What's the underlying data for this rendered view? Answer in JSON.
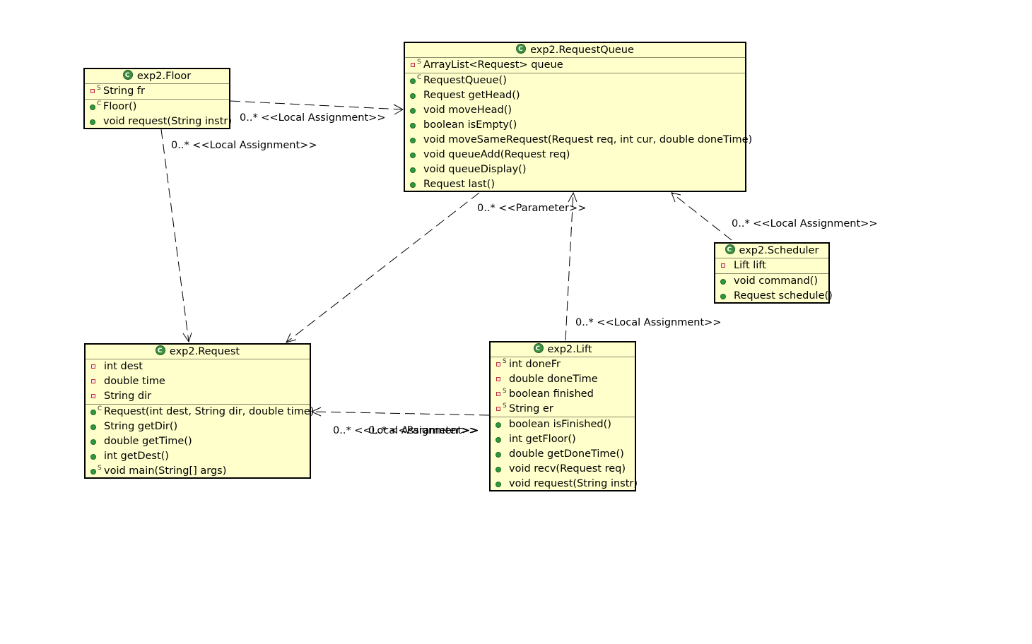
{
  "classes": {
    "floor": {
      "title": "exp2.Floor",
      "fields": [
        {
          "text": "String fr",
          "mod": "S"
        }
      ],
      "methods": [
        {
          "text": "Floor()",
          "mod": "C"
        },
        {
          "text": "void request(String instr)",
          "mod": ""
        }
      ]
    },
    "request_queue": {
      "title": "exp2.RequestQueue",
      "fields": [
        {
          "text": "ArrayList<Request> queue",
          "mod": "S"
        }
      ],
      "methods": [
        {
          "text": "RequestQueue()",
          "mod": "C"
        },
        {
          "text": "Request getHead()",
          "mod": ""
        },
        {
          "text": "void moveHead()",
          "mod": ""
        },
        {
          "text": "boolean isEmpty()",
          "mod": ""
        },
        {
          "text": "void moveSameRequest(Request req, int cur, double doneTime)",
          "mod": ""
        },
        {
          "text": "void queueAdd(Request req)",
          "mod": ""
        },
        {
          "text": "void queueDisplay()",
          "mod": ""
        },
        {
          "text": "Request last()",
          "mod": ""
        }
      ]
    },
    "scheduler": {
      "title": "exp2.Scheduler",
      "fields": [
        {
          "text": "Lift lift",
          "mod": ""
        }
      ],
      "methods": [
        {
          "text": "void command()",
          "mod": ""
        },
        {
          "text": "Request schedule()",
          "mod": ""
        }
      ]
    },
    "request": {
      "title": "exp2.Request",
      "fields": [
        {
          "text": "int dest",
          "mod": ""
        },
        {
          "text": "double time",
          "mod": ""
        },
        {
          "text": "String dir",
          "mod": ""
        }
      ],
      "methods": [
        {
          "text": "Request(int dest, String dir, double time)",
          "mod": "C"
        },
        {
          "text": "String getDir()",
          "mod": ""
        },
        {
          "text": "double getTime()",
          "mod": ""
        },
        {
          "text": "int getDest()",
          "mod": ""
        },
        {
          "text": "void main(String[] args)",
          "mod": "S"
        }
      ]
    },
    "lift": {
      "title": "exp2.Lift",
      "fields": [
        {
          "text": "int doneFr",
          "mod": "S"
        },
        {
          "text": "double doneTime",
          "mod": ""
        },
        {
          "text": "boolean finished",
          "mod": "S"
        },
        {
          "text": "String er",
          "mod": "S"
        }
      ],
      "methods": [
        {
          "text": "boolean isFinished()",
          "mod": ""
        },
        {
          "text": "int getFloor()",
          "mod": ""
        },
        {
          "text": "double getDoneTime()",
          "mod": ""
        },
        {
          "text": "void recv(Request req)",
          "mod": ""
        },
        {
          "text": "void request(String instr)",
          "mod": ""
        }
      ]
    }
  },
  "edge_labels": {
    "floor_to_queue": "0..* <<Local Assignment>>",
    "floor_to_request": "0..* <<Local Assignment>>",
    "queue_to_request": "0..* <<Parameter>>",
    "scheduler_to_queue": "0..* <<Local Assignment>>",
    "lift_to_queue": "0..* <<Local Assignment>>",
    "lift_to_request_assign": "0..* <<Local Assignment>>",
    "lift_to_request_param": "0..* <<Parameter>>"
  }
}
